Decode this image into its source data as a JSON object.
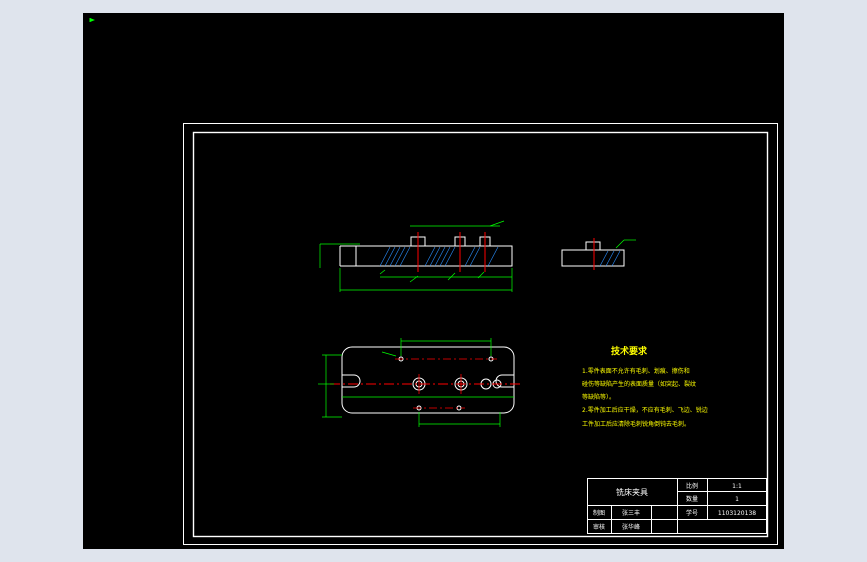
{
  "colors": {
    "background": "#000000",
    "border": "#ffffff",
    "geometry": "#ffffff",
    "dimensions": "#00ff00",
    "center_lines": "#ff0000",
    "hatch": "#2a8fff",
    "notes": "#ffff00",
    "title_block_text": "#ffffff",
    "ui_chrome": "#dfe4ed"
  },
  "viewport": {
    "ucs_icon": "ucs-corner-icon"
  },
  "technical_requirements": {
    "heading": "技术要求",
    "lines": [
      "1.零件表面不允许有毛刺、划痕、擦伤和",
      "碰伤等缺陷产生的表面质量（如突起、裂纹",
      "等缺陷等）。",
      "2.零件加工后应干燥，不应有毛刺、飞边、锐边",
      "工件加工后应清除毛刺锐角倒钝去毛刺。"
    ]
  },
  "title_block": {
    "part_name": "铣床夹具",
    "scale_label": "比例",
    "scale_value": "1:1",
    "quantity_label": "数量",
    "quantity_value": "1",
    "drawer_label": "制图",
    "drawer_value": "张三丰",
    "reviewer_label": "审核",
    "reviewer_value": "张华峰",
    "student_id_label": "学号",
    "student_id_value": "1103120138"
  }
}
